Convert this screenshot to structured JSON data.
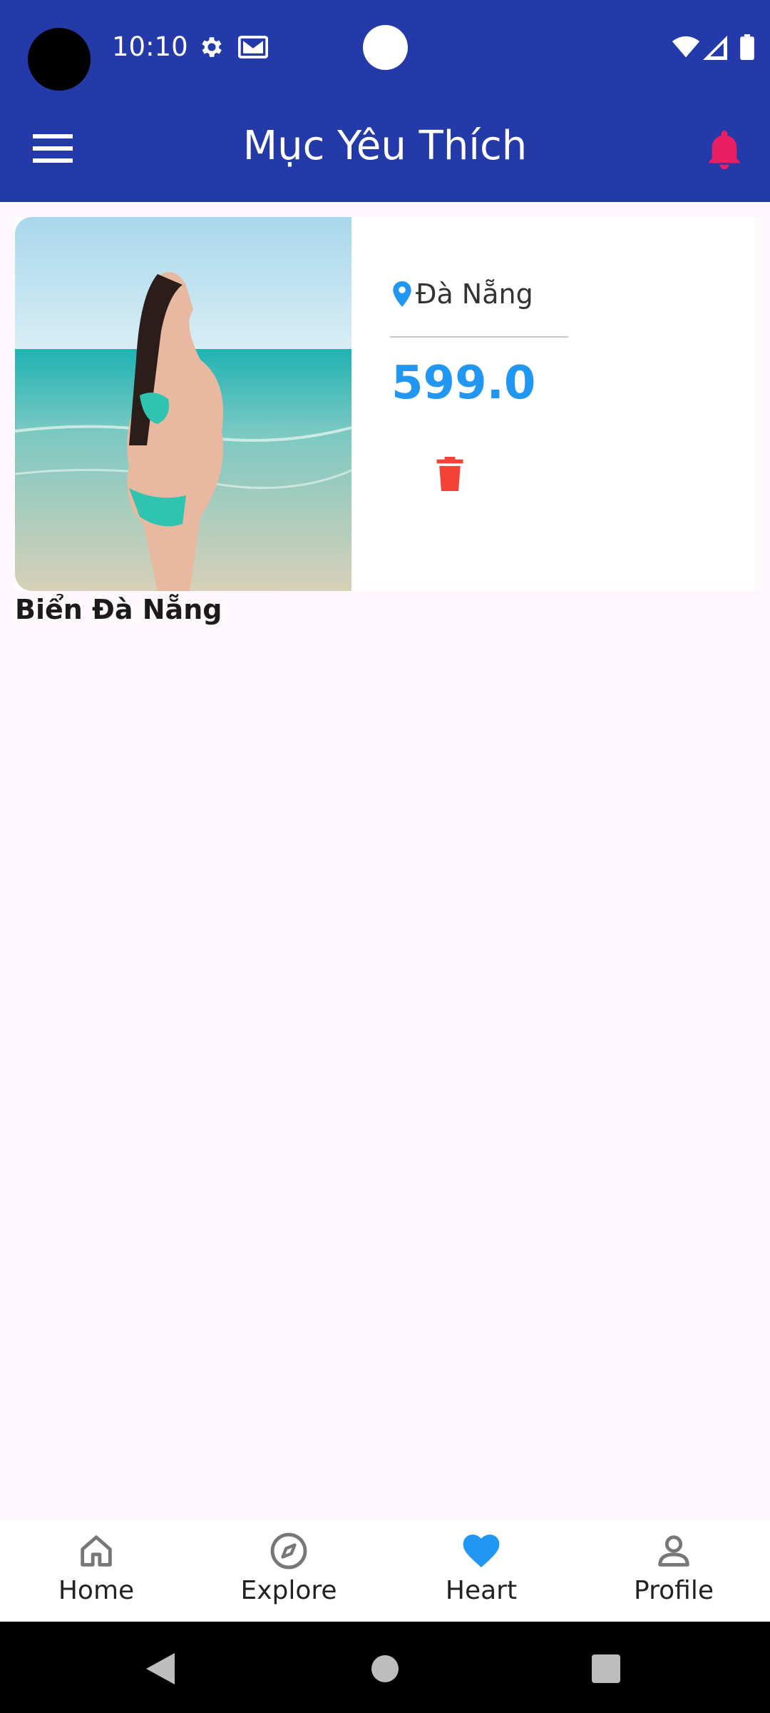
{
  "status_bar": {
    "time": "10:10",
    "icons": [
      "settings-icon",
      "gmail-icon",
      "wifi-icon",
      "signal-icon",
      "battery-icon"
    ]
  },
  "app_bar": {
    "title": "Mục Yêu Thích",
    "menu_icon": "menu-icon",
    "bell_icon": "bell-icon",
    "bell_color": "#e91e63",
    "background": "#233aa8"
  },
  "favorites": [
    {
      "name": "Biển Đà Nẵng",
      "location": "Đà Nẵng",
      "price": "599.0",
      "price_color": "#2196f3",
      "delete_icon": "trash-icon",
      "delete_color": "#f44336"
    }
  ],
  "bottom_nav": {
    "items": [
      {
        "label": "Home",
        "icon": "home-icon",
        "active": false
      },
      {
        "label": "Explore",
        "icon": "compass-icon",
        "active": false
      },
      {
        "label": "Heart",
        "icon": "heart-icon",
        "active": true
      },
      {
        "label": "Profile",
        "icon": "person-icon",
        "active": false
      }
    ],
    "active_color": "#2196f3"
  },
  "system_nav": {
    "icons": [
      "back-icon",
      "home-circle-icon",
      "recents-icon"
    ]
  }
}
